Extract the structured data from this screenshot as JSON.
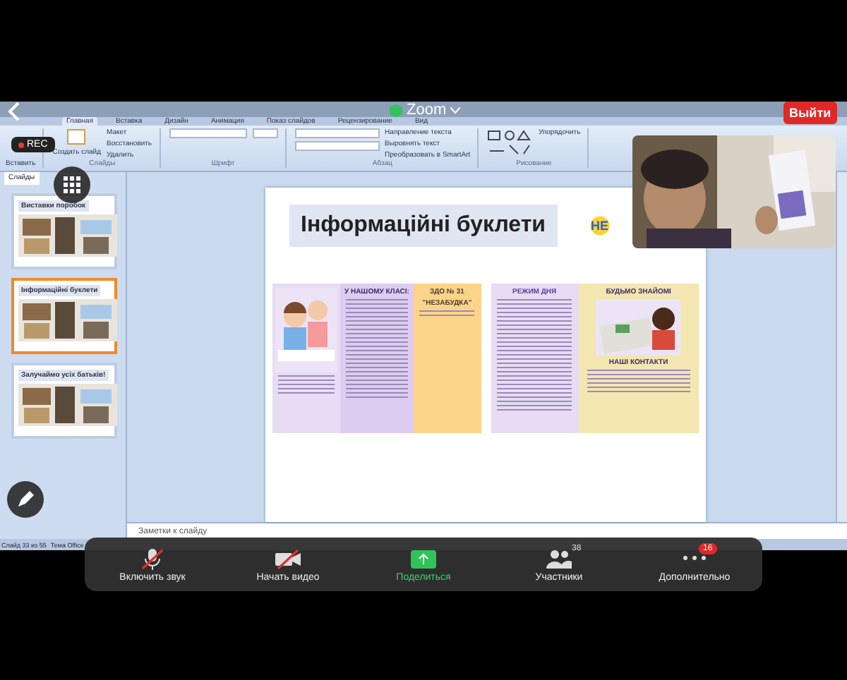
{
  "zoom": {
    "title": "Zoom",
    "leave": "Выйти",
    "rec": "REC"
  },
  "ppt": {
    "tabs": [
      {
        "label": "Главная",
        "selected": true
      },
      {
        "label": "Вставка",
        "selected": false
      },
      {
        "label": "Дизайн",
        "selected": false
      },
      {
        "label": "Анимация",
        "selected": false
      },
      {
        "label": "Показ слайдов",
        "selected": false
      },
      {
        "label": "Рецензирование",
        "selected": false
      },
      {
        "label": "Вид",
        "selected": false
      }
    ],
    "ribbon": {
      "paste": "Вставить",
      "new_slide": "Создать слайд",
      "slide_commands": [
        "Макет",
        "Восстановить",
        "Удалить"
      ],
      "text_commands": [
        "Направление текста",
        "Выровнять текст",
        "Преобразовать в SmartArt"
      ],
      "arrange": "Упорядочить",
      "group_labels": [
        "Слайды",
        "Шрифт",
        "Абзац",
        "Рисование"
      ]
    },
    "panel_tabs": [
      {
        "label": "Слайды",
        "selected": true
      }
    ],
    "thumbnails": [
      {
        "title": "Виставки поробок",
        "selected": false
      },
      {
        "title": "Інформаційні буклети",
        "selected": true
      },
      {
        "title": "Залучаймо усіх батьків!",
        "selected": false
      }
    ],
    "slide": {
      "title": "Інформаційні буклети",
      "logo": "НЕ",
      "booklets": [
        {
          "kind": "class",
          "heading": "У НАШОМУ КЛАСІ:",
          "name": "ЗДО № 31",
          "name2": "\"НЕЗАБУДКА\""
        },
        {
          "kind": "schedule",
          "heading": "РЕЖИМ ДНЯ",
          "name": "БУДЬМО ЗНАЙОМІ",
          "name2": "НАШІ КОНТАКТИ"
        }
      ]
    },
    "notes_placeholder": "Заметки к слайду",
    "status": [
      "Слайд 33 из 55",
      "Тема Office"
    ]
  },
  "toolbar": [
    {
      "label": "Включить звук",
      "kind": "mic",
      "off": true
    },
    {
      "label": "Начать видео",
      "kind": "video",
      "off": true
    },
    {
      "label": "Поделиться",
      "kind": "share"
    },
    {
      "label": "Участники",
      "kind": "people",
      "count": "38"
    },
    {
      "label": "Дополнительно",
      "kind": "more",
      "badge": "16"
    }
  ]
}
